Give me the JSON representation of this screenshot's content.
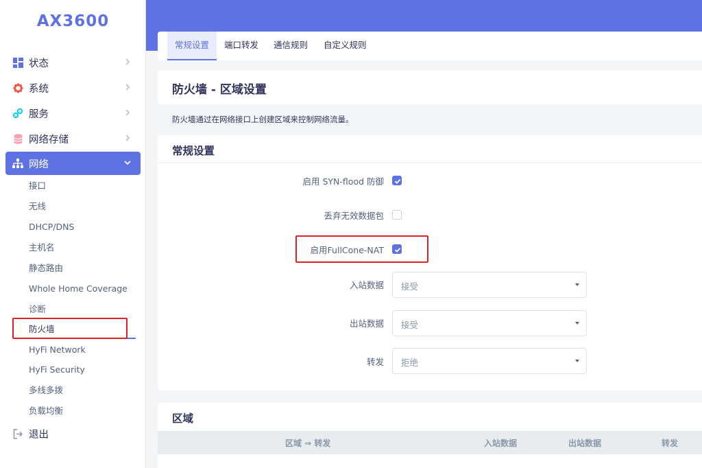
{
  "brand": "AX3600",
  "sidebar": {
    "items": [
      {
        "label": "状态"
      },
      {
        "label": "系统"
      },
      {
        "label": "服务"
      },
      {
        "label": "网络存储"
      },
      {
        "label": "网络"
      }
    ],
    "sub_items": [
      "接口",
      "无线",
      "DHCP/DNS",
      "主机名",
      "静态路由",
      "Whole Home Coverage",
      "诊断",
      "防火墙",
      "HyFi Network",
      "HyFi Security",
      "多线多拨",
      "负载均衡"
    ],
    "logout": "退出"
  },
  "tabs": [
    "常规设置",
    "端口转发",
    "通信规则",
    "自定义规则"
  ],
  "page": {
    "title": "防火墙 - 区域设置",
    "description": "防火墙通过在网络接口上创建区域来控制网络流量。"
  },
  "general": {
    "title": "常规设置",
    "syn_flood": {
      "label": "启用 SYN-flood 防御",
      "checked": true
    },
    "drop_invalid": {
      "label": "丢弃无效数据包",
      "checked": false
    },
    "fullcone": {
      "label": "启用FullCone-NAT",
      "checked": true
    },
    "input": {
      "label": "入站数据",
      "value": "接受"
    },
    "output": {
      "label": "出站数据",
      "value": "接受"
    },
    "forward": {
      "label": "转发",
      "value": "拒绝"
    }
  },
  "zones": {
    "title": "区域",
    "columns": [
      "区域 ⇒ 转发",
      "入站数据",
      "出站数据",
      "转发"
    ]
  },
  "colors": {
    "accent": "#5e72e4",
    "highlight": "#e02020"
  }
}
